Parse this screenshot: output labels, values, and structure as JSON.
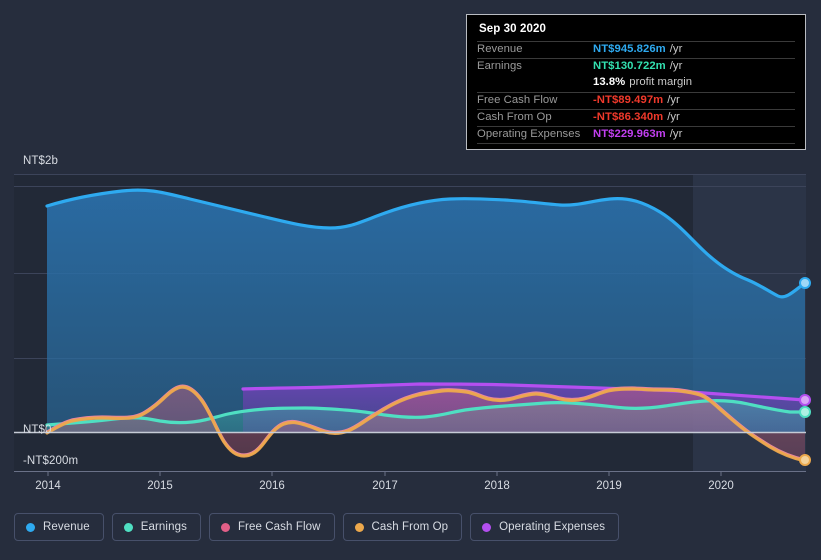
{
  "chart_data": {
    "type": "area",
    "title": "",
    "xlabel": "",
    "ylabel": "",
    "currency": "NT$",
    "grid": true,
    "legend_position": "bottom",
    "ylim": [
      -200,
      2000
    ],
    "y_unit": "millions NTD",
    "y_ticks": [
      {
        "label": "NT$2b",
        "value": 2000
      },
      {
        "label": "NT$0",
        "value": 0
      },
      {
        "label": "-NT$200m",
        "value": -200
      }
    ],
    "x_ticks": [
      "2014",
      "2015",
      "2016",
      "2017",
      "2018",
      "2019",
      "2020"
    ],
    "x_range": [
      "2013-10",
      "2020-09"
    ],
    "forecast_region_start": "2019-10",
    "series": [
      {
        "name": "Revenue",
        "color": "#2eaaf0",
        "x": [
          "2013-12",
          "2014-03",
          "2014-06",
          "2014-09",
          "2014-12",
          "2015-03",
          "2015-06",
          "2015-09",
          "2015-12",
          "2016-03",
          "2016-06",
          "2016-09",
          "2016-12",
          "2017-03",
          "2017-06",
          "2017-09",
          "2017-12",
          "2018-03",
          "2018-06",
          "2018-09",
          "2018-12",
          "2019-03",
          "2019-06",
          "2019-09",
          "2019-12",
          "2020-03",
          "2020-06",
          "2020-09"
        ],
        "values": [
          1720,
          1760,
          1790,
          1810,
          1800,
          1760,
          1720,
          1690,
          1665,
          1680,
          1700,
          1720,
          1740,
          1760,
          1780,
          1775,
          1760,
          1770,
          1790,
          1770,
          1755,
          1750,
          1745,
          1700,
          1580,
          1450,
          1330,
          1390
        ],
        "last_value": 945.826
      },
      {
        "name": "Earnings",
        "color": "#4fdfc2",
        "x": [
          "2013-12",
          "2014-03",
          "2014-06",
          "2014-09",
          "2014-12",
          "2015-03",
          "2015-06",
          "2015-09",
          "2015-12",
          "2016-03",
          "2016-06",
          "2016-09",
          "2016-12",
          "2017-03",
          "2017-06",
          "2017-09",
          "2017-12",
          "2018-03",
          "2018-06",
          "2018-09",
          "2018-12",
          "2019-03",
          "2019-06",
          "2019-09",
          "2019-12",
          "2020-03",
          "2020-06",
          "2020-09"
        ],
        "values": [
          55,
          52,
          48,
          52,
          58,
          55,
          50,
          48,
          52,
          60,
          68,
          70,
          72,
          68,
          60,
          65,
          80,
          95,
          105,
          110,
          108,
          100,
          98,
          110,
          125,
          130,
          128,
          130.722
        ],
        "last_value": 130.722
      },
      {
        "name": "Free Cash Flow",
        "color": "#e25f88",
        "x": [
          "2013-12",
          "2014-03",
          "2014-06",
          "2014-09",
          "2014-12",
          "2015-03",
          "2015-06",
          "2015-09",
          "2015-12",
          "2016-03",
          "2016-06",
          "2016-09",
          "2016-12",
          "2017-03",
          "2017-06",
          "2017-09",
          "2017-12",
          "2018-03",
          "2018-06",
          "2018-09",
          "2018-12",
          "2019-03",
          "2019-06",
          "2019-09",
          "2019-12",
          "2020-03",
          "2020-06",
          "2020-09"
        ],
        "values": [
          0,
          45,
          60,
          58,
          60,
          95,
          150,
          95,
          -50,
          -60,
          10,
          35,
          30,
          -10,
          10,
          60,
          100,
          135,
          150,
          75,
          40,
          50,
          90,
          100,
          80,
          10,
          -60,
          -89.497
        ],
        "last_value": -89.497
      },
      {
        "name": "Cash From Op",
        "color": "#eca84c",
        "x": [
          "2013-12",
          "2014-03",
          "2014-06",
          "2014-09",
          "2014-12",
          "2015-03",
          "2015-06",
          "2015-09",
          "2015-12",
          "2016-03",
          "2016-06",
          "2016-09",
          "2016-12",
          "2017-03",
          "2017-06",
          "2017-09",
          "2017-12",
          "2018-03",
          "2018-06",
          "2018-09",
          "2018-12",
          "2019-03",
          "2019-06",
          "2019-09",
          "2019-12",
          "2020-03",
          "2020-06",
          "2020-09"
        ],
        "values": [
          0,
          48,
          62,
          60,
          62,
          98,
          155,
          98,
          -48,
          -58,
          12,
          38,
          32,
          -8,
          12,
          62,
          102,
          138,
          152,
          78,
          42,
          52,
          92,
          102,
          82,
          12,
          -58,
          -86.34
        ],
        "last_value": -86.34
      },
      {
        "name": "Operating Expenses",
        "color": "#b44ff0",
        "x": [
          "2015-09",
          "2015-12",
          "2016-03",
          "2016-06",
          "2016-09",
          "2016-12",
          "2017-03",
          "2017-06",
          "2017-09",
          "2017-12",
          "2018-03",
          "2018-06",
          "2018-09",
          "2018-12",
          "2019-03",
          "2019-06",
          "2019-09",
          "2019-12",
          "2020-03",
          "2020-06",
          "2020-09"
        ],
        "values": [
          250,
          250,
          250,
          252,
          255,
          258,
          262,
          265,
          268,
          268,
          265,
          262,
          262,
          262,
          262,
          262,
          260,
          255,
          248,
          240,
          229.963
        ],
        "last_value": 229.963
      }
    ]
  },
  "tooltip": {
    "date": "Sep 30 2020",
    "rows": [
      {
        "key": "Revenue",
        "value": "NT$945.826m",
        "unit": "/yr",
        "color": "#2eaaf0"
      },
      {
        "key": "Earnings",
        "value": "NT$130.722m",
        "unit": "/yr",
        "color": "#4fdfc2"
      },
      {
        "key": "",
        "value": "13.8%",
        "unit": "profit margin",
        "color": "#ffffff"
      },
      {
        "key": "Free Cash Flow",
        "value": "-NT$89.497m",
        "unit": "/yr",
        "color": "#f0392b"
      },
      {
        "key": "Cash From Op",
        "value": "-NT$86.340m",
        "unit": "/yr",
        "color": "#f0392b"
      },
      {
        "key": "Operating Expenses",
        "value": "NT$229.963m",
        "unit": "/yr",
        "color": "#c13ff0"
      }
    ]
  },
  "legend": {
    "items": [
      {
        "label": "Revenue",
        "color": "#2eaaf0"
      },
      {
        "label": "Earnings",
        "color": "#4fdfc2"
      },
      {
        "label": "Free Cash Flow",
        "color": "#e25f88"
      },
      {
        "label": "Cash From Op",
        "color": "#eca84c"
      },
      {
        "label": "Operating Expenses",
        "color": "#b44ff0"
      }
    ]
  },
  "axis": {
    "y_top_label": "NT$2b",
    "y_zero_label": "NT$0",
    "y_neg_label": "-NT$200m",
    "x_labels": [
      "2014",
      "2015",
      "2016",
      "2017",
      "2018",
      "2019",
      "2020"
    ]
  }
}
